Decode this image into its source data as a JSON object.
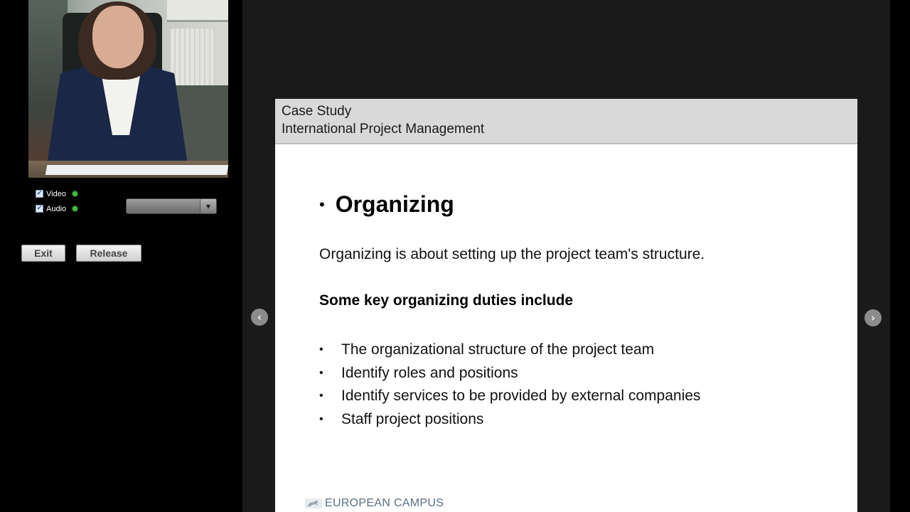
{
  "left_panel": {
    "controls": {
      "video_label": "Video",
      "audio_label": "Audio",
      "device_select_value": ""
    },
    "buttons": {
      "exit_label": "Exit",
      "release_label": "Release"
    }
  },
  "slide": {
    "header_line1": "Case Study",
    "header_line2": "International Project Management",
    "title_bullet": "•",
    "title": "Organizing",
    "intro": "Organizing is about setting up the project team's structure.",
    "subheading": "Some key organizing duties include",
    "duties": [
      "The organizational structure of the project team",
      "Identify roles and positions",
      "Identify services to be provided by external companies",
      "Staff project positions"
    ],
    "bullet": "•",
    "footer_logo_text": "EUROPEAN CAMPUS"
  },
  "nav": {
    "prev_icon": "‹",
    "next_icon": "›"
  },
  "colors": {
    "slide_header_bg": "#d9d9d9",
    "status_dot": "#3fbd3a",
    "logo_text": "#5a6f86"
  }
}
